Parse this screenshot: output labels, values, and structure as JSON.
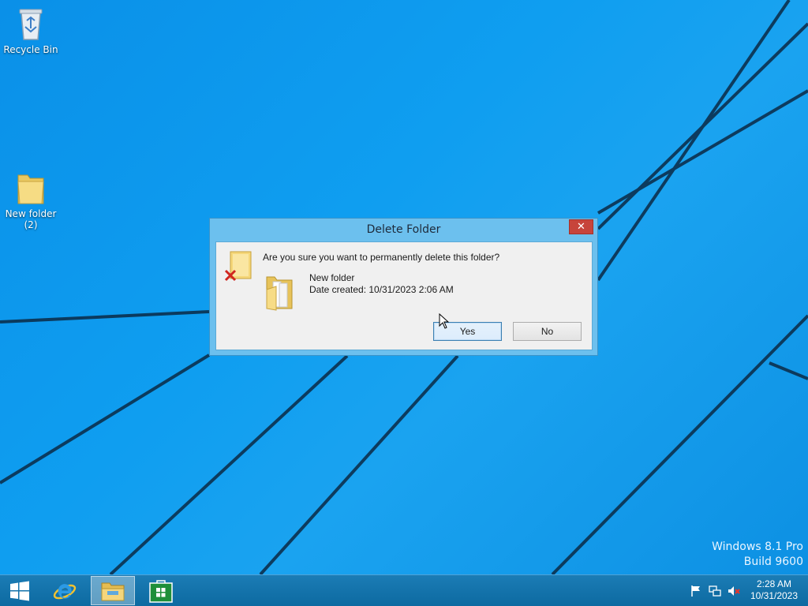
{
  "desktop": {
    "icons": [
      {
        "label": "Recycle Bin",
        "icon": "recycle-bin-icon"
      },
      {
        "label": "New folder",
        "sublabel": "(2)",
        "icon": "folder-icon"
      }
    ],
    "watermark": {
      "line1": "Windows 8.1 Pro",
      "line2": "Build 9600"
    }
  },
  "dialog": {
    "title": "Delete Folder",
    "close_label": "✕",
    "question": "Are you sure you want to permanently delete this folder?",
    "item_name": "New folder",
    "item_date": "Date created: 10/31/2023 2:06 AM",
    "yes_label": "Yes",
    "no_label": "No"
  },
  "taskbar": {
    "pinned": [
      {
        "name": "Start",
        "icon": "windows-logo-icon"
      },
      {
        "name": "Internet Explorer",
        "icon": "internet-explorer-icon"
      },
      {
        "name": "File Explorer",
        "icon": "file-explorer-icon",
        "active": true
      },
      {
        "name": "Store",
        "icon": "store-icon"
      }
    ],
    "tray": {
      "icons": [
        "flag-icon",
        "network-icon",
        "volume-muted-icon"
      ],
      "time": "2:28 AM",
      "date": "10/31/2023"
    }
  },
  "colors": {
    "desktop_blue": "#0f9ef0",
    "dialog_frame": "#6cc0ee",
    "close_red": "#c7443b",
    "taskbar": "#0f6fa8"
  }
}
